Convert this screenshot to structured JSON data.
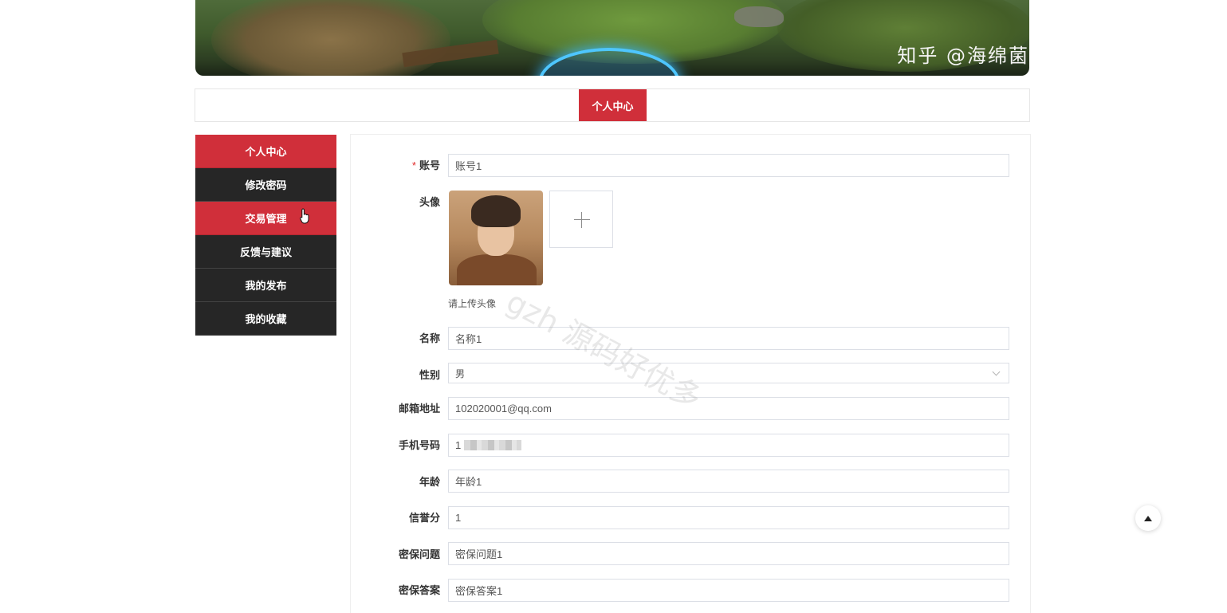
{
  "banner": {
    "watermark": "知乎 @海绵菌"
  },
  "tabs": [
    {
      "label": "个人中心",
      "active": true
    }
  ],
  "sidebar": {
    "items": [
      {
        "label": "个人中心",
        "active": true
      },
      {
        "label": "修改密码",
        "active": false
      },
      {
        "label": "交易管理",
        "active": true,
        "hovered": true
      },
      {
        "label": "反馈与建议",
        "active": false
      },
      {
        "label": "我的发布",
        "active": false
      },
      {
        "label": "我的收藏",
        "active": false
      }
    ]
  },
  "form": {
    "account": {
      "required_mark": "*",
      "label": "账号",
      "value": "账号1"
    },
    "avatar": {
      "label": "头像",
      "hint": "请上传头像"
    },
    "name": {
      "label": "名称",
      "value": "名称1"
    },
    "gender": {
      "label": "性别",
      "value": "男"
    },
    "email": {
      "label": "邮箱地址",
      "value": "102020001@qq.com"
    },
    "phone": {
      "label": "手机号码",
      "value": "1"
    },
    "age": {
      "label": "年龄",
      "value": "年龄1"
    },
    "credit": {
      "label": "信誉分",
      "value": "1"
    },
    "security_question": {
      "label": "密保问题",
      "value": "密保问题1"
    },
    "security_answer": {
      "label": "密保答案",
      "value": "密保答案1"
    }
  },
  "overlay_watermark": "gzh 源码好优多",
  "colors": {
    "accent": "#d02f3a",
    "sidebar_bg": "#262626"
  },
  "icons": {
    "upload": "plus-icon",
    "back_to_top": "caret-up-icon",
    "cursor": "hand-pointer-icon"
  }
}
